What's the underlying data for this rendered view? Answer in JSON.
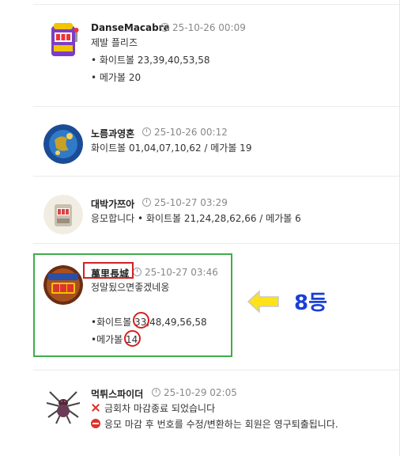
{
  "posts": [
    {
      "name": "DanseMacabre",
      "time": "25-10-26 00:09",
      "lines": [
        "제발 플리즈",
        "• 화이트볼 23,39,40,53,58",
        "• 메가볼 20"
      ]
    },
    {
      "name": "노름과영혼",
      "time": "25-10-26 00:12",
      "lines": [
        "화이트볼 01,04,07,10,62 / 메가볼 19"
      ]
    },
    {
      "name": "대박가쯔아",
      "time": "25-10-27 03:29",
      "lines": [
        "응모합니다 • 화이트볼 21,24,28,62,66 / 메가볼 6"
      ]
    },
    {
      "name": "萬里長城",
      "time": "25-10-27 03:46",
      "lines": [
        "정말됬으면좋겠네옹",
        "•화이트볼 33,48,49,56,58",
        "•메가볼 14"
      ]
    },
    {
      "name": "먹튀스파이더",
      "time": "25-10-29 02:05",
      "lines": [
        "금회차 마감종료 되었습니다",
        "응모 마감 후 번호를 수정/변환하는 회원은 영구퇴출됩니다."
      ]
    }
  ],
  "annotation": {
    "rank_label": "8등",
    "highlight_color": "#3fae4a",
    "mark_color": "#d32020",
    "arrow_color": "#ffe21a",
    "rank_color": "#1a3fd6"
  },
  "icons": [
    "clock-icon",
    "x-mark-icon",
    "no-entry-icon",
    "arrow-left-icon"
  ]
}
